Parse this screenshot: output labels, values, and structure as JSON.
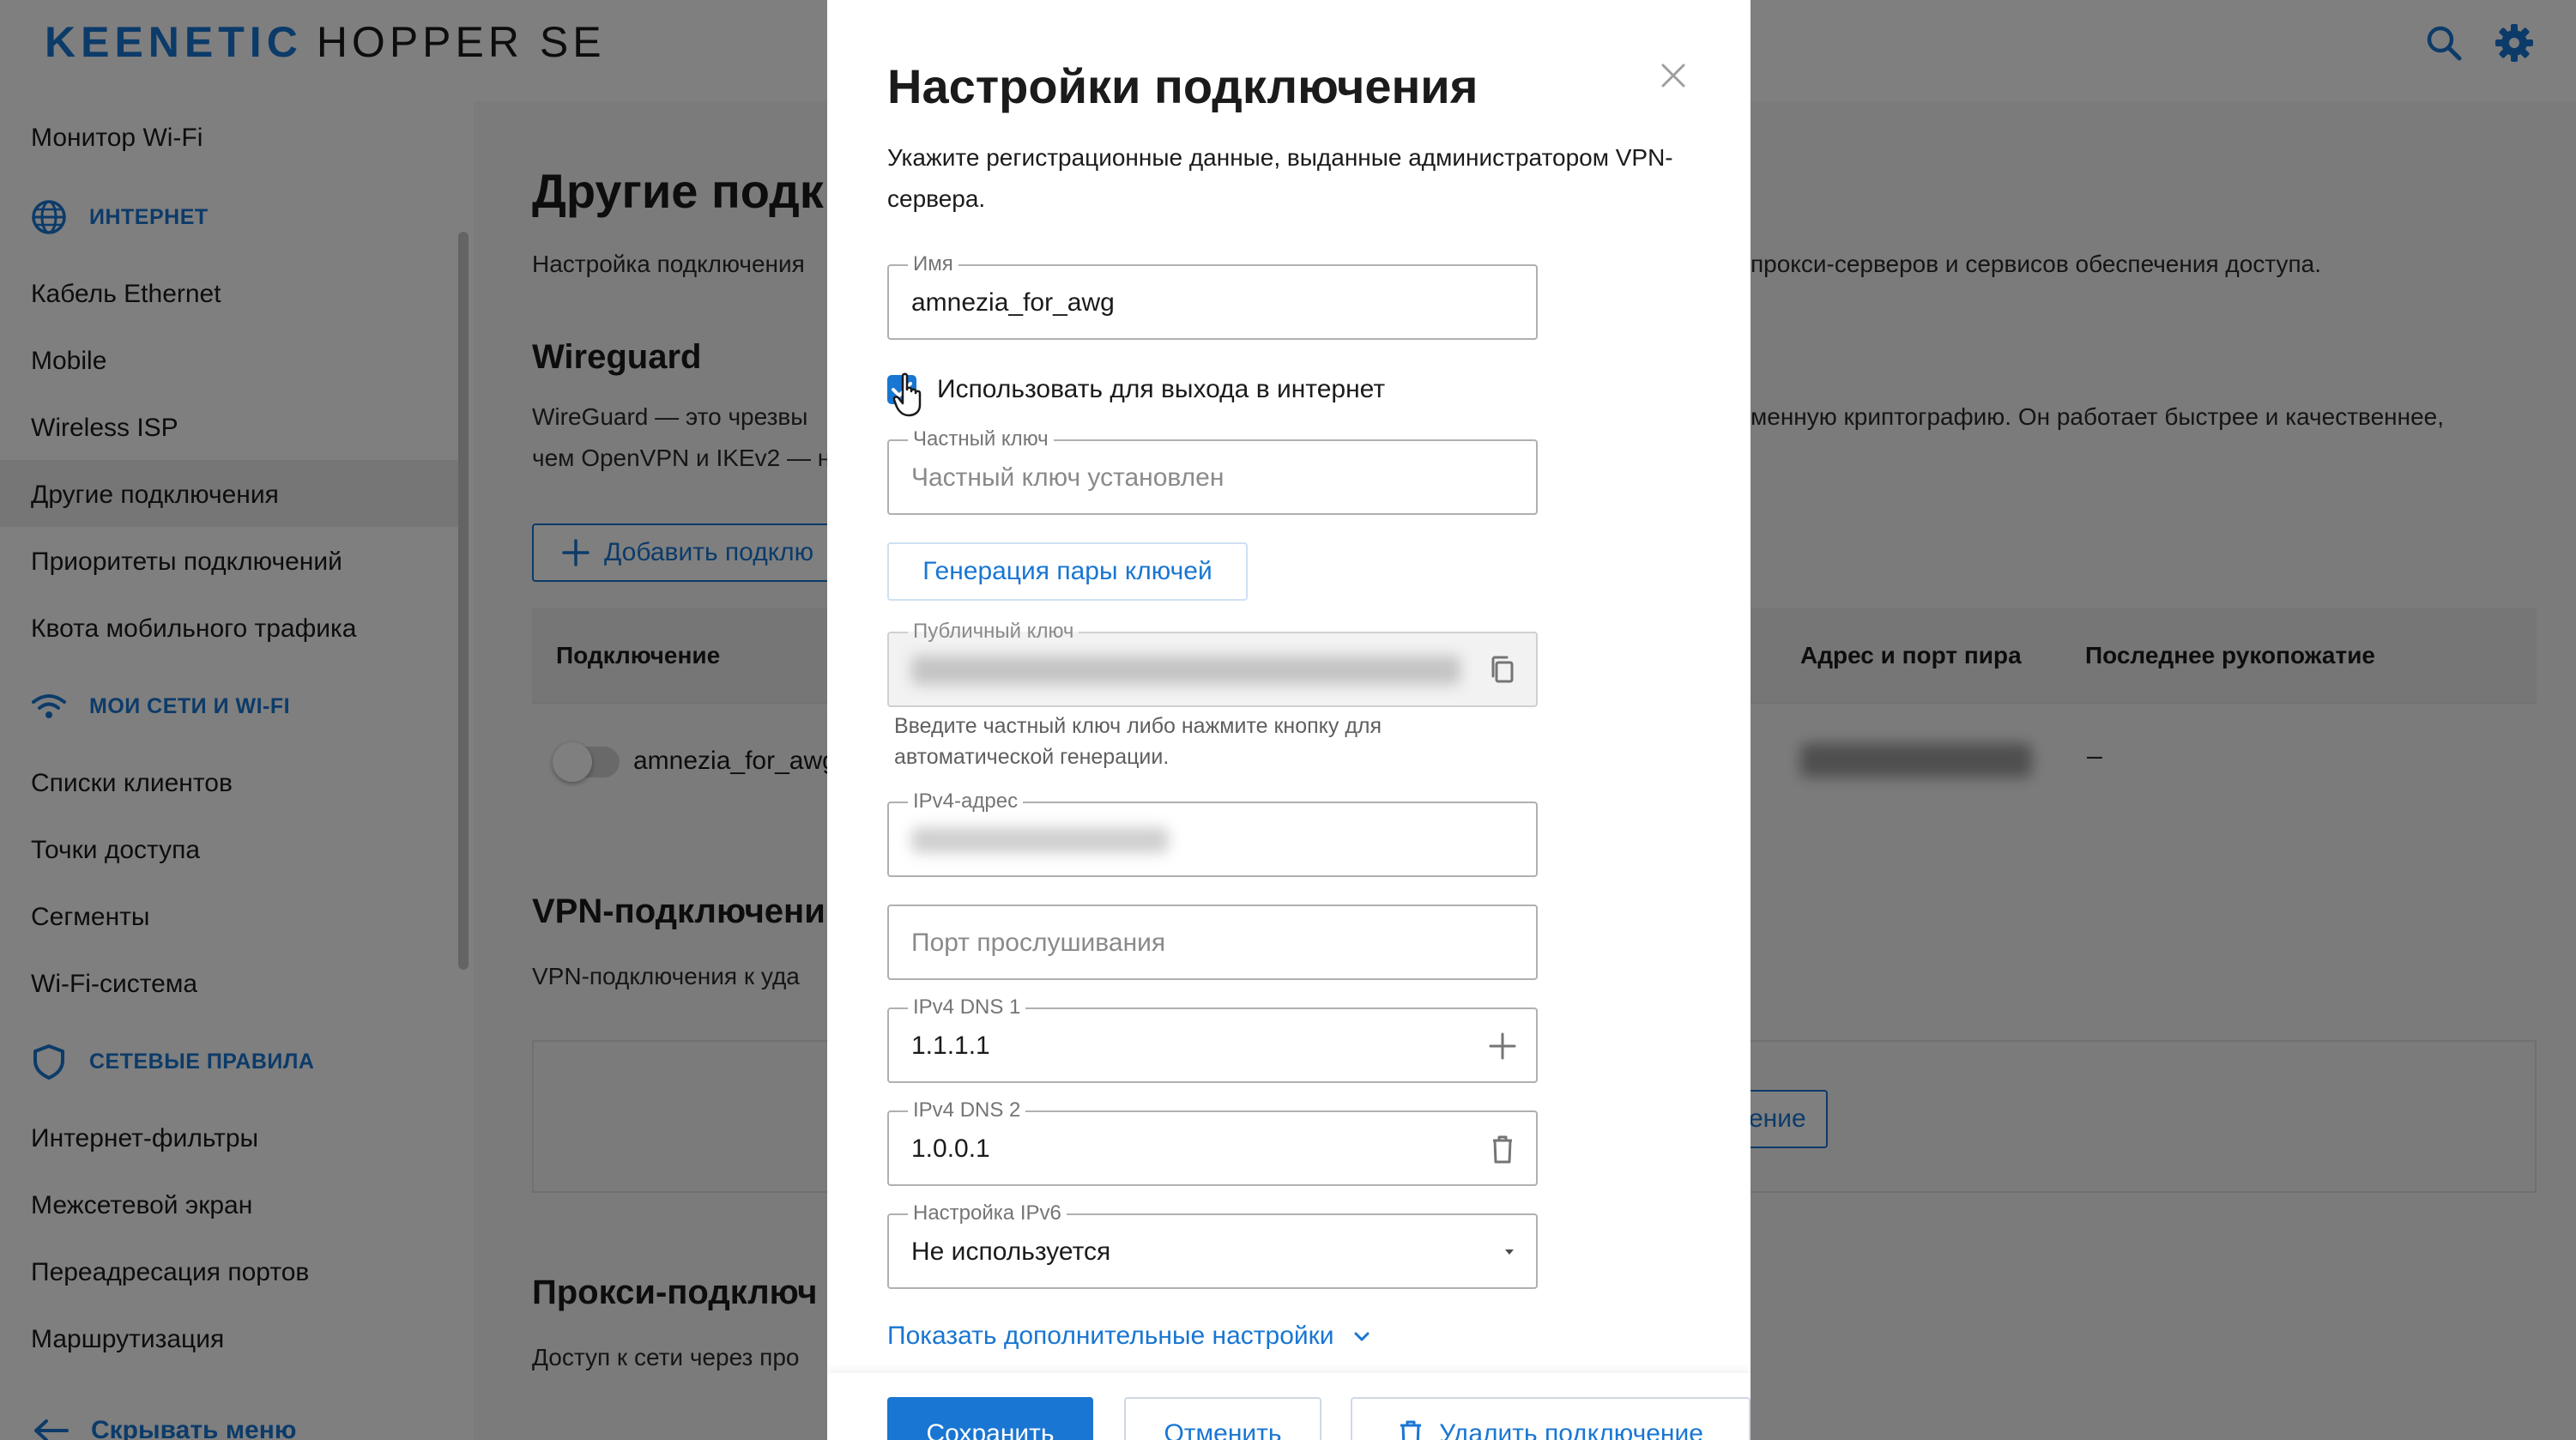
{
  "header": {
    "brand": "KEENETIC",
    "model": "HOPPER SE",
    "search_icon": "search-icon",
    "settings_icon": "gear-icon",
    "accent_color": "#1976d2"
  },
  "sidebar": {
    "items": [
      {
        "label": "Монитор Wi-Fi"
      },
      {
        "section": "Интернет",
        "icon": "globe-icon"
      },
      {
        "label": "Кабель Ethernet"
      },
      {
        "label": "Mobile"
      },
      {
        "label": "Wireless ISP"
      },
      {
        "label": "Другие подключения",
        "active": true
      },
      {
        "label": "Приоритеты подключений"
      },
      {
        "label": "Квота мобильного трафика"
      },
      {
        "section": "Мои сети и Wi-Fi",
        "icon": "wifi-icon"
      },
      {
        "label": "Списки клиентов"
      },
      {
        "label": "Точки доступа"
      },
      {
        "label": "Сегменты"
      },
      {
        "label": "Wi-Fi-система"
      },
      {
        "section": "Сетевые правила",
        "icon": "shield-icon"
      },
      {
        "label": "Интернет-фильтры"
      },
      {
        "label": "Межсетевой экран"
      },
      {
        "label": "Переадресация портов"
      },
      {
        "label": "Маршрутизация"
      }
    ],
    "hide_menu_label": "Скрывать меню"
  },
  "main": {
    "page_title": "Другие подк",
    "page_desc_left": "Настройка подключения",
    "page_desc_right": "прокси-серверов и сервисов обеспечения доступа.",
    "wireguard": {
      "title": "Wireguard",
      "desc_line1_left": "WireGuard — это чрезвы",
      "desc_line1_right": "менную криптографию. Он работает быстрее и качественнее,",
      "desc_line2_left": "чем OpenVPN и IKEv2 — н",
      "add_label": "Добавить подклю"
    },
    "table": {
      "columns": [
        "Подключение",
        "Адрес и порт пира",
        "Последнее рукопожатие"
      ],
      "rows": [
        {
          "name": "amnezia_for_awg",
          "enabled": false,
          "handshake": "–"
        }
      ]
    },
    "vpn": {
      "title": "VPN-подключени",
      "desc": "VPN-подключения к уда",
      "button_partial": "ение"
    },
    "proxy": {
      "title": "Прокси-подключ",
      "desc": "Доступ к сети через про"
    }
  },
  "dialog": {
    "title": "Настройки подключения",
    "close_icon": "close-icon",
    "description": "Укажите регистрационные данные, выданные администратором VPN-сервера.",
    "name_label": "Имя",
    "name_value": "amnezia_for_awg",
    "use_for_internet_label": "Использовать для выхода в интернет",
    "use_for_internet_checked": true,
    "private_key_label": "Частный ключ",
    "private_key_placeholder": "Частный ключ установлен",
    "generate_button": "Генерация пары ключей",
    "public_key_label": "Публичный ключ",
    "copy_icon": "copy-icon",
    "public_key_hint": "Введите частный ключ либо нажмите кнопку для автоматической генерации.",
    "ipv4_address_label": "IPv4-адрес",
    "listen_port_placeholder": "Порт прослушивания",
    "dns1_label": "IPv4 DNS 1",
    "dns1_value": "1.1.1.1",
    "dns2_label": "IPv4 DNS 2",
    "dns2_value": "1.0.0.1",
    "ipv6_label": "Настройка IPv6",
    "ipv6_value": "Не используется",
    "show_more_label": "Показать дополнительные настройки",
    "save_button": "Сохранить",
    "cancel_button": "Отменить",
    "delete_button": "Удалить подключение"
  }
}
